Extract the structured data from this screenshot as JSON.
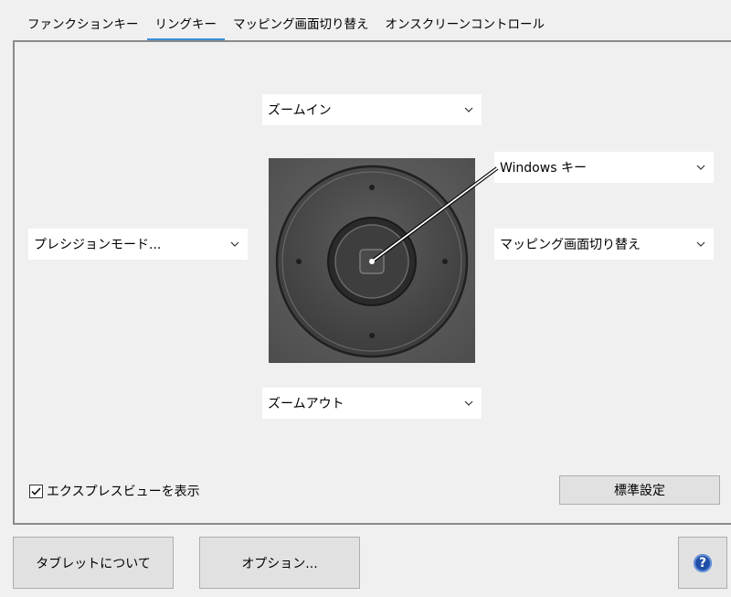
{
  "tabs": [
    {
      "label": "ファンクションキー",
      "active": false
    },
    {
      "label": "リングキー",
      "active": true
    },
    {
      "label": "マッピング画面切り替え",
      "active": false
    },
    {
      "label": "オンスクリーンコントロール",
      "active": false
    }
  ],
  "ring": {
    "top": {
      "value": "ズームイン"
    },
    "left": {
      "value": "プレシジョンモード..."
    },
    "center": {
      "value": "Windows キー"
    },
    "right": {
      "value": "マッピング画面切り替え"
    },
    "bottom": {
      "value": "ズームアウト"
    }
  },
  "express_view": {
    "label": "エクスプレスビューを表示",
    "checked": true
  },
  "buttons": {
    "defaults": "標準設定",
    "about": "タブレットについて",
    "options": "オプション...",
    "help_glyph": "?"
  },
  "icons": {
    "chevron": "chevron-down-icon",
    "check": "check-icon",
    "help": "help-icon"
  },
  "colors": {
    "active_tab_underline": "#3a8fd6",
    "help_icon": "#1f4fa8",
    "panel_border": "#8a8a8a"
  }
}
